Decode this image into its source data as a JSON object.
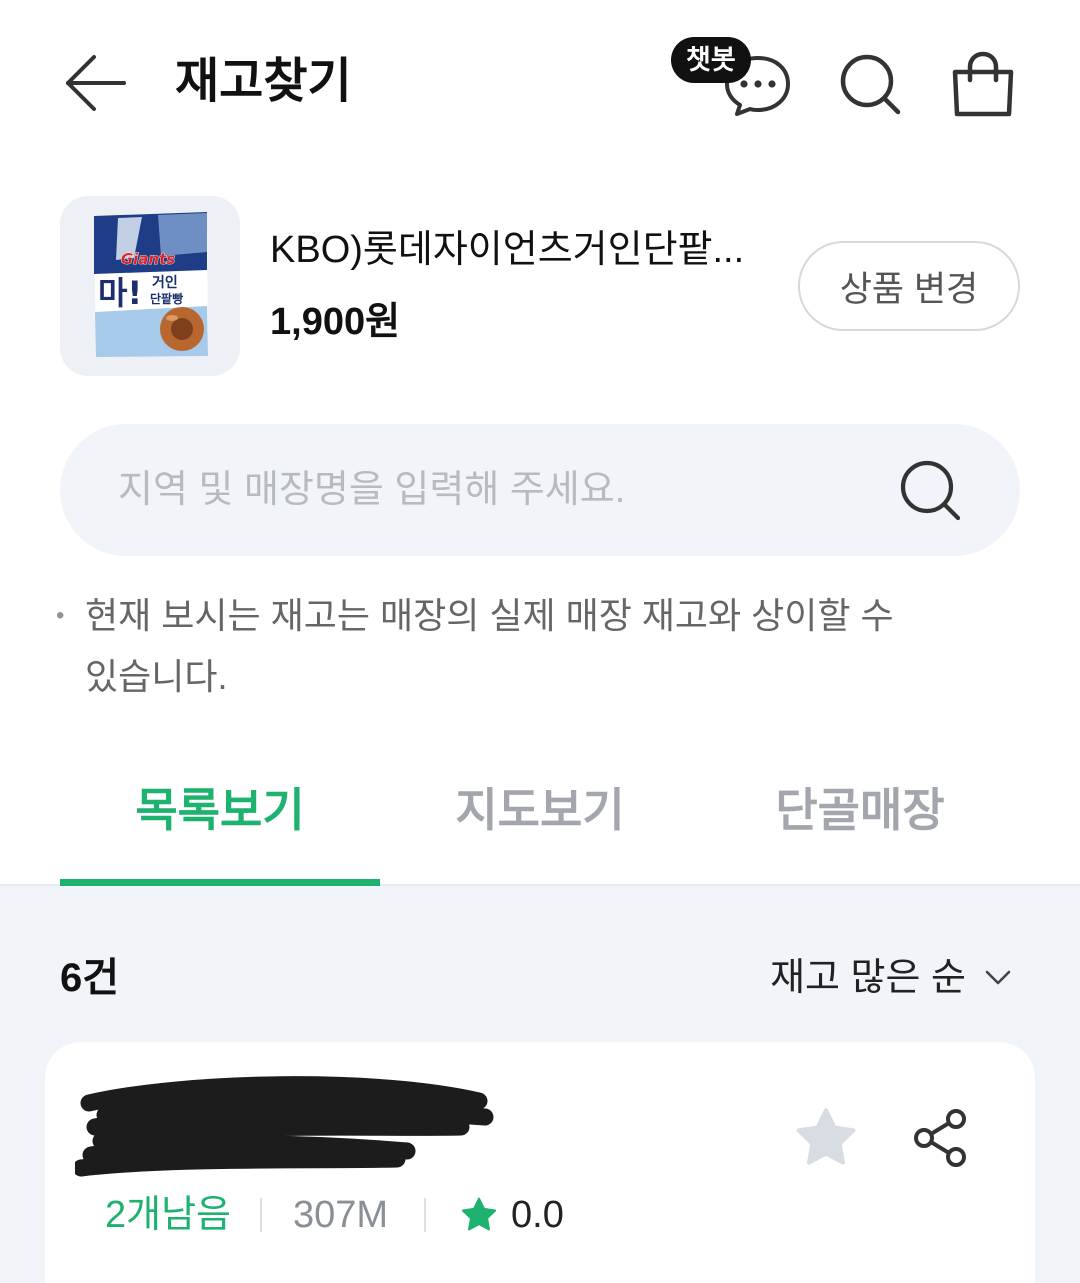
{
  "header": {
    "title": "재고찾기",
    "chatbot_badge": "챗봇",
    "icons": {
      "back": "back-arrow-icon",
      "chatbot": "chat-bubble-icon",
      "search": "search-icon",
      "cart": "shopping-bag-icon"
    }
  },
  "product": {
    "name": "KBO)롯데자이언츠거인단팥...",
    "price": "1,900원",
    "change_button_label": "상품 변경",
    "image": {
      "brand_logo": "Giants",
      "headline": "마!",
      "title_line1": "거인",
      "title_line2": "단팥빵"
    }
  },
  "search": {
    "placeholder": "지역 및 매장명을 입력해 주세요.",
    "value": "",
    "icon": "search-icon"
  },
  "notice": {
    "bullet": "•",
    "text": "현재 보시는 재고는 매장의 실제 매장 재고와 상이할 수 있습니다."
  },
  "tabs": {
    "active_index": 0,
    "items": [
      {
        "label": "목록보기"
      },
      {
        "label": "지도보기"
      },
      {
        "label": "단골매장"
      }
    ]
  },
  "results": {
    "count_label": "6건",
    "sort_label": "재고 많은 순",
    "sort_icon": "chevron-down-icon"
  },
  "stores": [
    {
      "name_redacted": true,
      "favorite": false,
      "stock_label": "2개남음",
      "distance": "307M",
      "rating": "0.0",
      "icons": {
        "favorite": "star-icon",
        "share": "share-icon",
        "rating": "rating-star-icon"
      }
    }
  ],
  "colors": {
    "accent": "#1db26e",
    "panel_background": "#f1f4f9",
    "star_inactive": "#d8dce3"
  }
}
